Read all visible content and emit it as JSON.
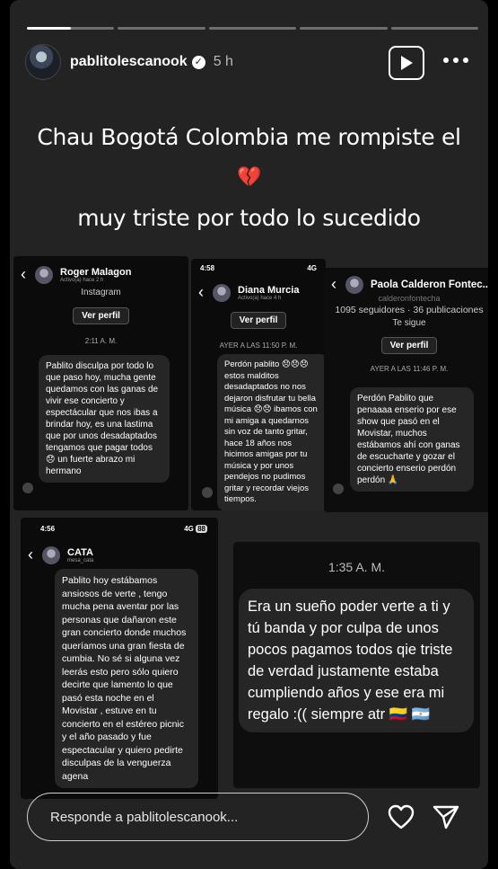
{
  "progress": {
    "segments": 5,
    "active_index": 0,
    "active_fill": 0.5
  },
  "header": {
    "username": "pablitolescanook",
    "verified_icon": "verified-badge-icon",
    "time": "5 h",
    "play_icon": "play-icon",
    "more_icon": "more-dots-icon"
  },
  "caption": {
    "line1": "Chau Bogotá Colombia me rompiste el",
    "line2": "💔",
    "line3": "muy triste por todo lo sucedido"
  },
  "panel1": {
    "name": "Roger Malagon",
    "status": "Activo(a) hace 2 h",
    "subtitle": "Instagram",
    "button": "Ver perfil",
    "time": "2:11 A. M.",
    "message": "Pablito disculpa por todo lo que paso hoy, mucha gente quedamos con las ganas de vivir ese concierto y espectácular que nos ibas a brindar hoy, es una lastima que por unos desadaptados tengamos que pagar todos 😞 un fuerte abrazo mi hermano"
  },
  "panel2": {
    "status_time": "4:58",
    "status_signal": "4G",
    "name": "Diana Murcia",
    "status": "Activo(a) hace 4 h",
    "button": "Ver perfil",
    "time": "AYER A LAS 11:50 P. M.",
    "message": "Perdón pablito 😞😞😞 estos malditos desadaptados no nos dejaron disfrutar tu bella música 😞😞 ibamos con mi amiga a quedarnos sin voz de tanto gritar, hace 18 años nos hicimos amigas por tu música y por unos pendejos no pudimos gritar y recordar viejos tiempos."
  },
  "panel3": {
    "name": "Paola Calderon Fontec...",
    "handle": "calderonfontecha",
    "stats": "1095 seguidores · 36 publicaciones",
    "follows": "Te sigue",
    "button": "Ver perfil",
    "time": "AYER A LAS 11:46 P. M.",
    "message": "Perdón Pablito que penaaaa enserio por ese show que pasó en el Movistar, muchos estábamos ahí con ganas de escucharte y gozar el concierto enserio perdón perdón 🙏"
  },
  "panel4": {
    "status_time": "4:56",
    "status_signal": "4G",
    "battery": "88",
    "name": "CATA",
    "handle": "mesa_cata",
    "message": "Pablito hoy estábamos ansiosos de verte , tengo mucha pena aventar por las personas que dañaron este gran concierto donde muchos queríamos una gran fiesta de cumbia. No sé si alguna vez leerás esto pero sólo quiero decirte que lamento lo que pasó esta noche en el Movistar , estuve en tu concierto en el estéreo picnic y el año pasado y fue espectacular y quiero pedirte disculpas de la venguerza agena"
  },
  "panel5": {
    "time": "1:35 A. M.",
    "message": "Era un sueño poder verte a ti y tú banda y por culpa de unos pocos pagamos todos qie triste de verdad justamente estaba cumpliendo años y ese era mi regalo :(( siempre atr 🇨🇴 🇦🇷"
  },
  "reply": {
    "placeholder": "Responde a pablitolescanook...",
    "heart_icon": "heart-icon",
    "send_icon": "send-icon"
  }
}
